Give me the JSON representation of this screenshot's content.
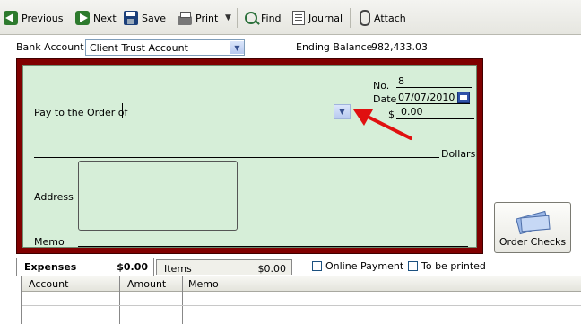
{
  "toolbar": {
    "previous": "Previous",
    "next": "Next",
    "save": "Save",
    "print": "Print",
    "find": "Find",
    "journal": "Journal",
    "attach": "Attach"
  },
  "bank": {
    "label": "Bank Account",
    "account": "Client Trust Account",
    "ending_balance_label": "Ending Balance",
    "ending_balance": "982,433.03"
  },
  "check": {
    "no_label": "No.",
    "no_value": "8",
    "date_label": "Date",
    "date_value": "07/07/2010",
    "amount_label": "$",
    "amount_value": "0.00",
    "pay_to_label": "Pay to the Order of",
    "pay_to_value": "",
    "dollars_label": "Dollars",
    "address_label": "Address",
    "memo_label": "Memo"
  },
  "order_checks": {
    "label": "Order Checks"
  },
  "tabs": [
    {
      "label": "Expenses",
      "amount": "$0.00",
      "active": true
    },
    {
      "label": "Items",
      "amount": "$0.00",
      "active": false
    }
  ],
  "options": {
    "online_payment": "Online Payment",
    "to_be_printed": "To be printed"
  },
  "grid": {
    "columns": [
      "Account",
      "Amount",
      "Memo"
    ]
  },
  "colors": {
    "check_background": "#d6eed8",
    "check_border": "#800000",
    "annotation_arrow": "#e01010"
  }
}
